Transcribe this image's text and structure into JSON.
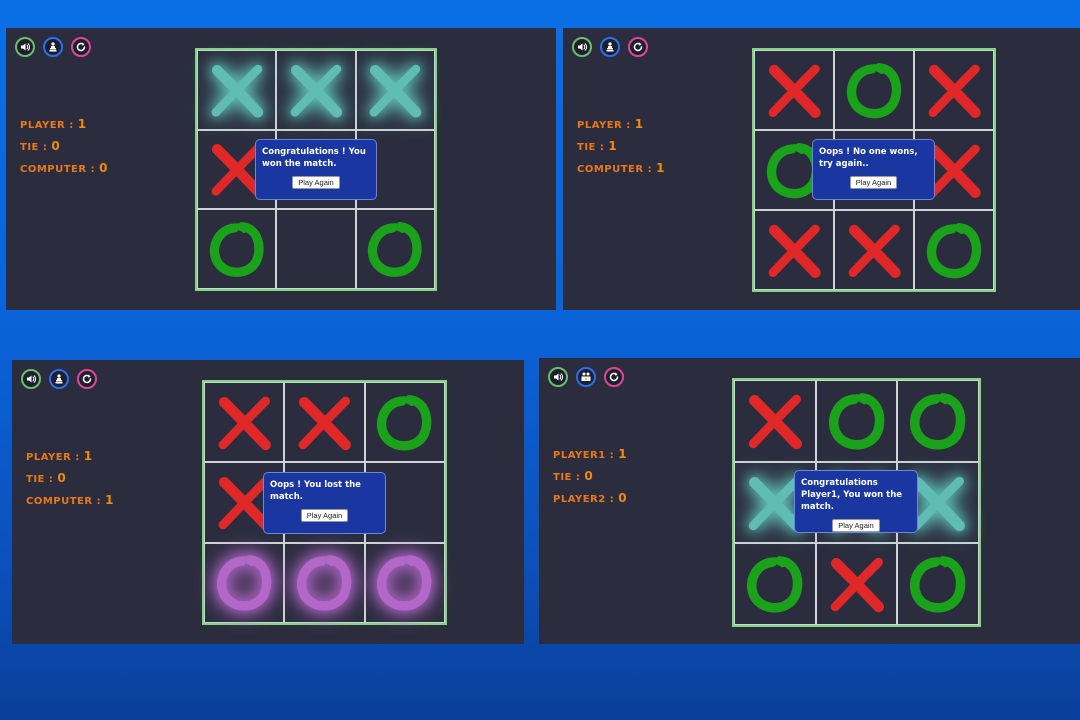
{
  "colors": {
    "red": "#e02828",
    "green": "#1aa21a",
    "teal": "#5fbdb5",
    "purple": "#b267c9",
    "sound_ring": "#6bbf6b",
    "mode_ring": "#2b6ef0",
    "restart_ring": "#e0479a"
  },
  "panels": [
    {
      "mode_icon": "single-player-icon",
      "scores": [
        {
          "label": "PLAYER :",
          "value": "1"
        },
        {
          "label": "TIE :",
          "value": "0"
        },
        {
          "label": "COMPUTER :",
          "value": "0"
        }
      ],
      "cells": [
        {
          "mark": "X",
          "color": "teal",
          "glow": true
        },
        {
          "mark": "X",
          "color": "teal",
          "glow": true
        },
        {
          "mark": "X",
          "color": "teal",
          "glow": true
        },
        {
          "mark": "X",
          "color": "red"
        },
        {
          "mark": ""
        },
        {
          "mark": ""
        },
        {
          "mark": "O",
          "color": "green"
        },
        {
          "mark": ""
        },
        {
          "mark": "O",
          "color": "green"
        }
      ],
      "popup": {
        "message": "Congratulations ! You won the match.",
        "button": "Play Again"
      }
    },
    {
      "mode_icon": "single-player-icon",
      "scores": [
        {
          "label": "PLAYER :",
          "value": "1"
        },
        {
          "label": "TIE :",
          "value": "1"
        },
        {
          "label": "COMPUTER :",
          "value": "1"
        }
      ],
      "cells": [
        {
          "mark": "X",
          "color": "red"
        },
        {
          "mark": "O",
          "color": "green"
        },
        {
          "mark": "X",
          "color": "red"
        },
        {
          "mark": "O",
          "color": "green"
        },
        {
          "mark": ""
        },
        {
          "mark": "X",
          "color": "red"
        },
        {
          "mark": "X",
          "color": "red"
        },
        {
          "mark": "X",
          "color": "red"
        },
        {
          "mark": "O",
          "color": "green"
        }
      ],
      "popup": {
        "message": "Oops ! No one wons, try again..",
        "button": "Play Again"
      }
    },
    {
      "mode_icon": "single-player-icon",
      "scores": [
        {
          "label": "PLAYER :",
          "value": "1"
        },
        {
          "label": "TIE :",
          "value": "0"
        },
        {
          "label": "COMPUTER :",
          "value": "1"
        }
      ],
      "cells": [
        {
          "mark": "X",
          "color": "red"
        },
        {
          "mark": "X",
          "color": "red"
        },
        {
          "mark": "O",
          "color": "green"
        },
        {
          "mark": "X",
          "color": "red"
        },
        {
          "mark": ""
        },
        {
          "mark": ""
        },
        {
          "mark": "O",
          "color": "purple",
          "glow": true
        },
        {
          "mark": "O",
          "color": "purple",
          "glow": true
        },
        {
          "mark": "O",
          "color": "purple",
          "glow": true
        }
      ],
      "popup": {
        "message": "Oops ! You lost the match.",
        "button": "Play Again"
      }
    },
    {
      "mode_icon": "two-players-icon",
      "scores": [
        {
          "label": "PLAYER1 :",
          "value": "1"
        },
        {
          "label": "TIE :",
          "value": "0"
        },
        {
          "label": "PLAYER2 :",
          "value": "0"
        }
      ],
      "cells": [
        {
          "mark": "X",
          "color": "red"
        },
        {
          "mark": "O",
          "color": "green"
        },
        {
          "mark": "O",
          "color": "green"
        },
        {
          "mark": "X",
          "color": "teal",
          "glow": true
        },
        {
          "mark": "X",
          "color": "teal",
          "glow": true
        },
        {
          "mark": "X",
          "color": "teal",
          "glow": true
        },
        {
          "mark": "O",
          "color": "green"
        },
        {
          "mark": "X",
          "color": "red"
        },
        {
          "mark": "O",
          "color": "green"
        }
      ],
      "popup": {
        "message": "Congratulations Player1, You won the match.",
        "button": "Play Again"
      }
    }
  ]
}
